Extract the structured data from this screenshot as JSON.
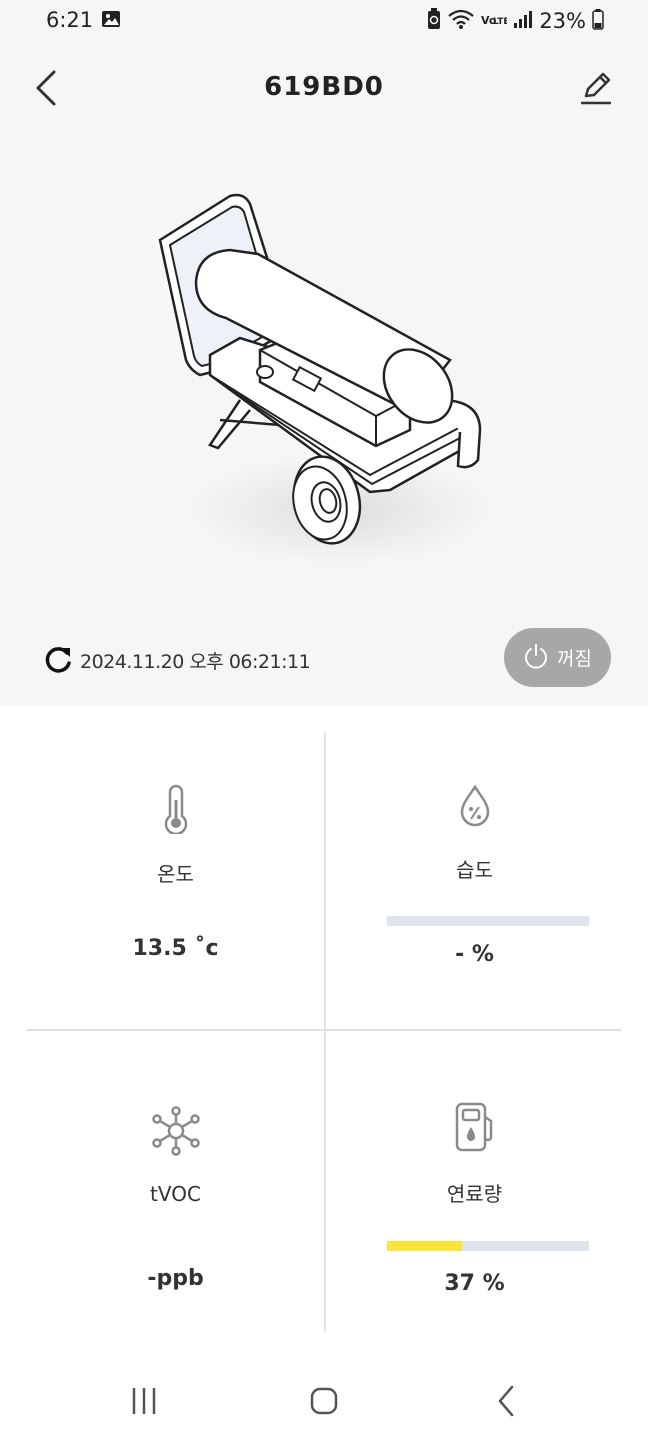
{
  "status_bar": {
    "time": "6:21",
    "network_label": "Vo LTE",
    "battery": "23%",
    "icons": [
      "gallery-icon",
      "battery-saver-icon",
      "wifi-icon",
      "volte-icon",
      "signal-icon",
      "battery-icon"
    ]
  },
  "header": {
    "title": "619BD0",
    "back_icon": "chevron-left-icon",
    "edit_icon": "pencil-icon"
  },
  "device": {
    "image": "oil-heater-illustration",
    "last_updated": "2024.11.20  오후 06:21:11",
    "power_state_label": "꺼짐"
  },
  "sensors": {
    "temperature": {
      "label": "온도",
      "value": "13.5 ˚c",
      "icon": "thermometer-icon"
    },
    "humidity": {
      "label": "습도",
      "value": "- %",
      "level": 0,
      "icon": "humidity-drop-icon"
    },
    "tvoc": {
      "label": "tVOC",
      "value": "-ppb",
      "icon": "molecule-icon"
    },
    "fuel": {
      "label": "연료량",
      "value": "37 %",
      "level": 0.37,
      "icon": "fuel-pump-icon"
    }
  },
  "colors": {
    "top_background": "#f6f6f6",
    "power_button": "#a7a7a7",
    "bar_track": "#dfe3eb",
    "bar_fill": "#f8e43a"
  },
  "nav_bar": {
    "icons": [
      "recent-apps-icon",
      "home-icon",
      "back-icon"
    ]
  }
}
